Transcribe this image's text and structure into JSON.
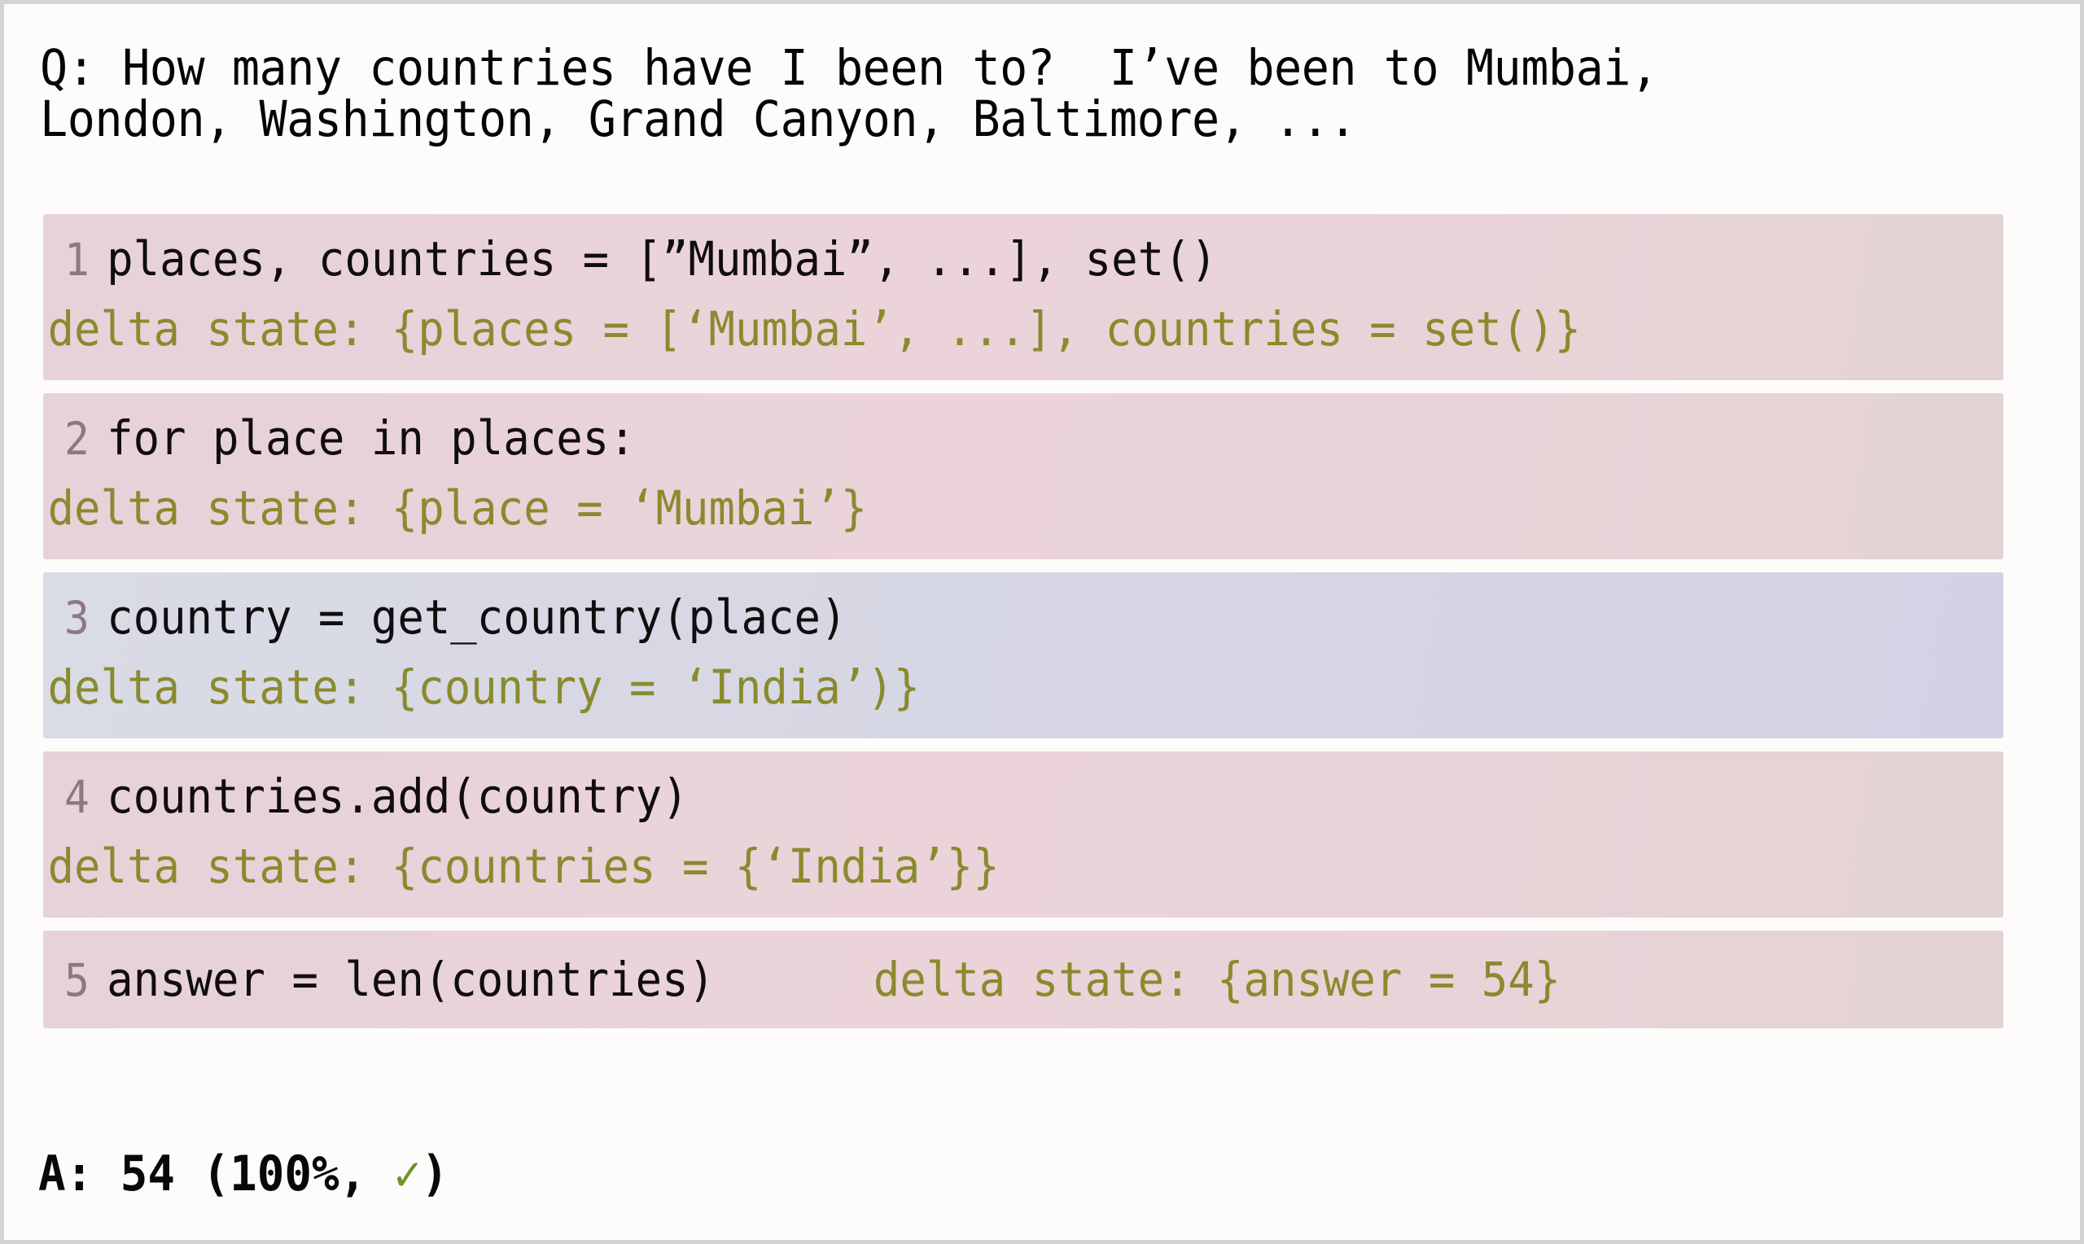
{
  "question": {
    "label": "Q:",
    "text": "Q: How many countries have I been to?  I’ve been to Mumbai,\nLondon, Washington, Grand Canyon, Baltimore, ..."
  },
  "steps": [
    {
      "number": "1",
      "code": "places, countries = [”Mumbai”, ...], set()",
      "delta": "delta state: {places = [‘Mumbai’, ...], countries = set()}",
      "highlight": "pink",
      "inline": false
    },
    {
      "number": "2",
      "code": "for place in places:",
      "delta": "delta state: {place = ‘Mumbai’}",
      "highlight": "pink",
      "inline": false
    },
    {
      "number": "3",
      "code": "country = get_country(place)",
      "delta": "delta state: {country = ‘India’)}",
      "highlight": "blue",
      "inline": false
    },
    {
      "number": "4",
      "code": "countries.add(country)",
      "delta": "delta state: {countries = {‘India’}}",
      "highlight": "pink",
      "inline": false
    },
    {
      "number": "5",
      "code": "answer = len(countries)",
      "delta": "delta state: {answer = 54}",
      "highlight": "pink",
      "inline": true
    }
  ],
  "answer": {
    "prefix": "A: 54 (100%, ",
    "check_icon": "✓",
    "suffix": ")"
  },
  "colors": {
    "card_background": "#fdfcfb",
    "card_border": "#d5d4d4",
    "highlight_pink": "#e9d3d9",
    "highlight_blue": "#d6d6e4",
    "delta_text": "#8a8a2e",
    "line_number": "#8e7880",
    "code_text": "#100d0e",
    "check_green": "#6f9425"
  }
}
